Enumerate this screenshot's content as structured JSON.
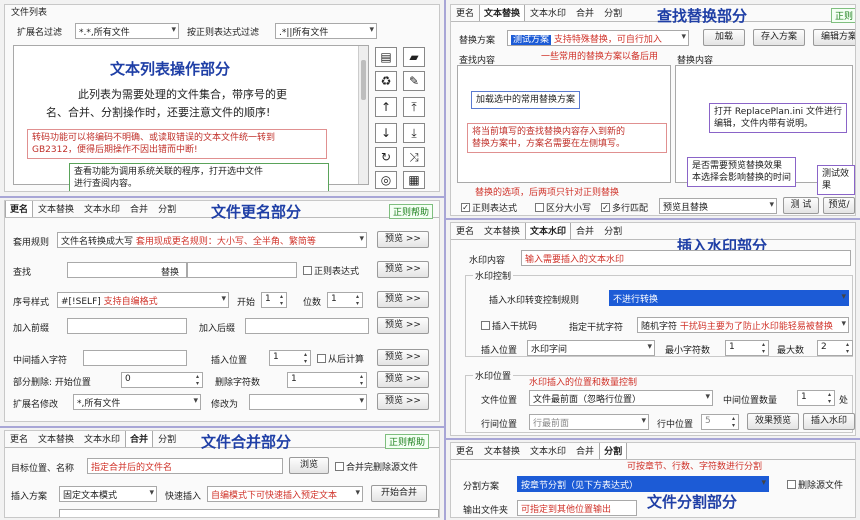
{
  "file_list": {
    "group_label": "文件列表",
    "ext_filter_label": "扩展名过滤",
    "ext_filter_value": "*.*,所有文件",
    "regex_filter_label": "按正则表达式过滤",
    "regex_filter_value": ".*||所有文件",
    "title": "文本列表操作部分",
    "desc_line1": "此列表为需要处理的文件集合，带序号的更",
    "desc_line2": "名、合并、分割操作时，还要注意文件的顺序!",
    "callout_convert_line1": "转码功能可以将编码不明确、或读取错误的文本文件统一转到",
    "callout_convert_line2": "GB2312，便得后期操作不因出错而中断!",
    "callout_view_line1": "查看功能为调用系统关联的程序，打开选中文件",
    "callout_view_line2": "进行查阅内容。"
  },
  "rename": {
    "tabs": [
      "更名",
      "文本替换",
      "文本水印",
      "合并",
      "分割"
    ],
    "help": "正则帮助",
    "title": "文件更名部分",
    "rule_label": "套用规则",
    "rule_value": "文件名转换成大写",
    "rule_note": "套用现成更名规则：大小写、全半角、繁简等",
    "preview": "预览 >>",
    "find_label": "查找",
    "replace_label": "替换",
    "regex_label": "正则表达式",
    "seq_label": "序号样式",
    "seq_value": "#[!SELF]",
    "seq_note": "支持自编格式",
    "start_label": "开始",
    "start_value": "1",
    "digits_label": "位数",
    "digits_value": "1",
    "prefix_label": "加入前缀",
    "suffix_label": "加入后缀",
    "mid_insert_label": "中间插入字符",
    "insert_pos_label": "插入位置",
    "insert_pos_value": "1",
    "from_back_label": "从后计算",
    "partial_del_label": "部分删除: 开始位置",
    "partial_del_start": "0",
    "del_count_label": "删除字符数",
    "del_count_value": "1",
    "ext_modify_label": "扩展名修改",
    "ext_modify_value": "*,所有文件",
    "modify_to_label": "修改为"
  },
  "merge": {
    "tabs": [
      "更名",
      "文本替换",
      "文本水印",
      "合并",
      "分割"
    ],
    "help": "正则帮助",
    "title": "文件合并部分",
    "target_label": "目标位置、名称",
    "target_placeholder": "指定合并后的文件名",
    "browse": "浏览",
    "delete_source": "合并完删除源文件",
    "insert_mode_label": "插入方案",
    "insert_mode_value": "固定文本模式",
    "quick_insert_label": "快速插入",
    "quick_note": "自编模式下可快速插入预定文本",
    "start_merge": "开始合并"
  },
  "replace": {
    "tabs": [
      "更名",
      "文本替换",
      "文本水印",
      "合并",
      "分割"
    ],
    "help": "正则",
    "title": "查找替换部分",
    "scheme_label": "替换方案",
    "scheme_value": "测试方案",
    "scheme_note": "支持特殊替换，可自行加入",
    "load": "加载",
    "save_scheme": "存入方案",
    "edit_scheme": "编辑方案",
    "common_note": "一些常用的替换方案以备后用",
    "find_content_label": "查找内容",
    "replace_content_label": "替换内容",
    "callout_load": "加载选中的常用替换方案",
    "callout_save_line1": "将当前填写的查找替换内容存入到新的",
    "callout_save_line2": "替换方案中，方案名需要在左侧填写。",
    "callout_edit_line1": "打开 ReplacePlan.ini 文件进行",
    "callout_edit_line2": "编辑，文件内带有说明。",
    "callout_preview_line1": "是否需要预览替换效果",
    "callout_preview_line2": "本选择会影响替换的时间",
    "callout_test": "测试效果",
    "options_note": "替换的选项，后两项只针对正则替换",
    "opt_regex": "正则表达式",
    "opt_case": "区分大小写",
    "opt_multiline": "多行匹配",
    "preview_mode_value": "预览且替换",
    "test_btn": "测 试",
    "preview_btn": "预览/"
  },
  "watermark": {
    "tabs": [
      "更名",
      "文本替换",
      "文本水印",
      "合并",
      "分割"
    ],
    "title": "插入水印部分",
    "content_label": "水印内容",
    "content_placeholder": "输入需要插入的文本水印",
    "control_group": "水印控制",
    "convert_rule_label": "插入水印转变控制规则",
    "convert_rule_value": "不进行转换",
    "insert_noise_label": "插入干扰码",
    "noise_char_label": "指定干扰字符",
    "noise_char_value": "随机字符",
    "noise_note": "干扰码主要为了防止水印能轻易被替换",
    "insert_pos_label": "插入位置",
    "insert_pos_value": "水印字间",
    "min_chars_label": "最小字符数",
    "min_chars_value": "1",
    "max_label": "最大数",
    "max_value": "2",
    "position_group": "水印位置",
    "file_pos_label": "文件位置",
    "file_pos_value": "文件最前面（忽略行位置）",
    "mid_count_label": "中间位置数量",
    "mid_count_value": "1",
    "position_note": "水印插入的位置和数量控制",
    "row_pos_label": "行间位置",
    "row_pos_value": "行最前面",
    "row_mid_label": "行中位置",
    "row_mid_value": "5",
    "effect_preview": "效果预览",
    "insert_watermark": "插入水印",
    "unit_char": "处"
  },
  "split": {
    "tabs": [
      "更名",
      "文本替换",
      "文本水印",
      "合并",
      "分割"
    ],
    "title": "文件分割部分",
    "scheme_label": "分割方案",
    "scheme_value": "按章节分割（见下方表达式）",
    "scheme_note": "可按章节、行数、字符数进行分割",
    "delete_source": "删除源文件",
    "output_label": "输出文件夹",
    "output_placeholder": "可指定到其他位置输出"
  },
  "icons": [
    "document-icon",
    "folder-icon",
    "delete-icon",
    "edit-icon",
    "up-arrow-icon",
    "top-arrow-icon",
    "down-arrow-icon",
    "bottom-arrow-icon",
    "refresh-icon",
    "shuffle-icon",
    "view-icon",
    "qr-icon"
  ]
}
